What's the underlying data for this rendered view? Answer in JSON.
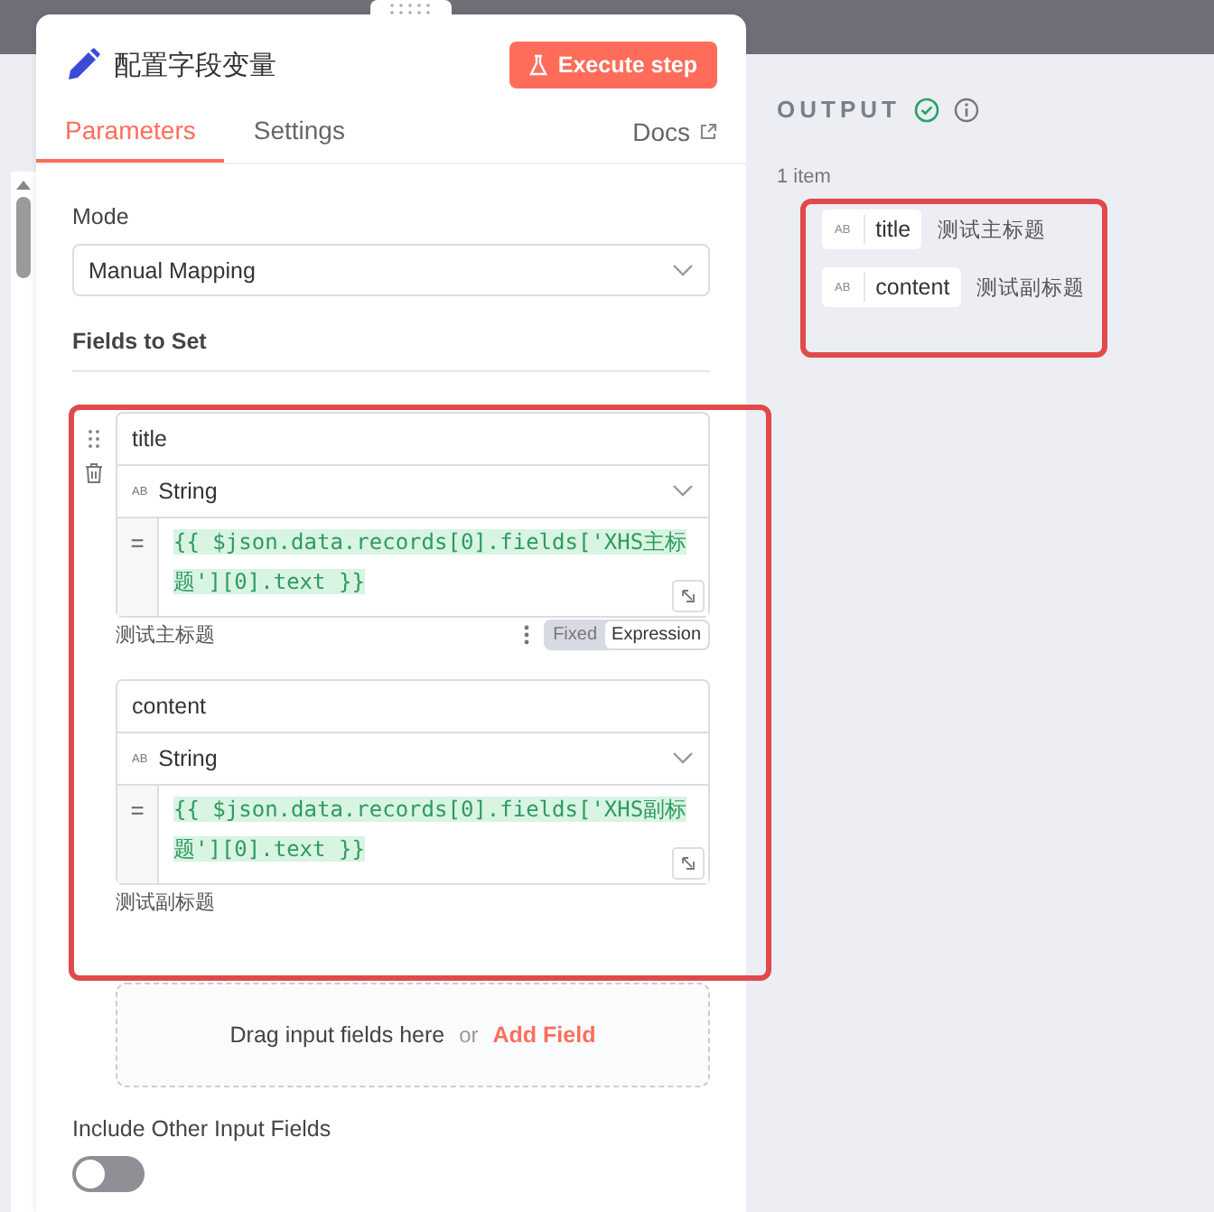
{
  "panel": {
    "title": "配置字段变量",
    "execute_button": "Execute step",
    "tabs": [
      {
        "label": "Parameters",
        "selected": true
      },
      {
        "label": "Settings",
        "selected": false
      }
    ],
    "docs_link": "Docs",
    "mode": {
      "label": "Mode",
      "value": "Manual Mapping"
    },
    "fields_label": "Fields to Set",
    "fields": [
      {
        "name": "title",
        "type_badge": "AB",
        "type": "String",
        "operator": "=",
        "expression": "{{ $json.data.records[0].fields['XHS主标题'][0].text }}",
        "result": "测试主标题",
        "mode_options": [
          {
            "label": "Fixed",
            "selected": false
          },
          {
            "label": "Expression",
            "selected": true
          }
        ]
      },
      {
        "name": "content",
        "type_badge": "AB",
        "type": "String",
        "operator": "=",
        "expression": "{{ $json.data.records[0].fields['XHS副标题'][0].text }}",
        "result": "测试副标题"
      }
    ],
    "drop_zone": {
      "hint": "Drag input fields here",
      "or": "or",
      "add_link": "Add Field"
    },
    "include_other": {
      "label": "Include Other Input Fields",
      "on": false
    }
  },
  "output": {
    "title": "OUTPUT",
    "count": "1 item",
    "items": [
      {
        "type_badge": "AB",
        "key": "title",
        "value": "测试主标题"
      },
      {
        "type_badge": "AB",
        "key": "content",
        "value": "测试副标题"
      }
    ]
  }
}
